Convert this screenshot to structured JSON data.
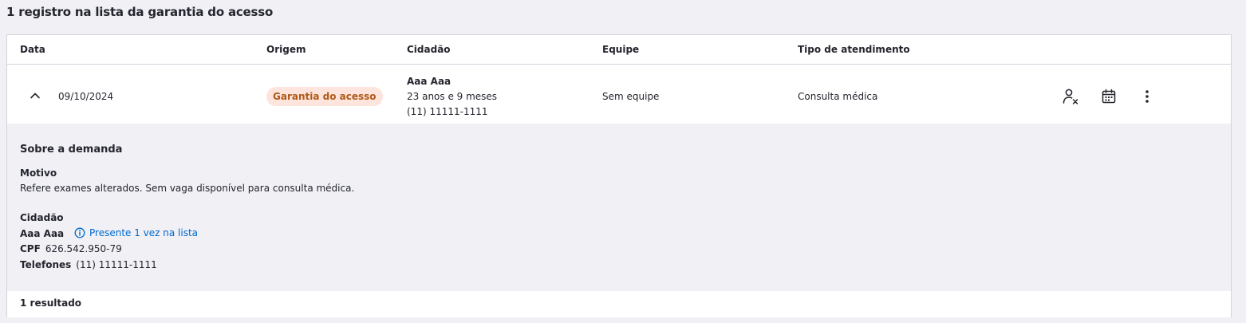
{
  "page": {
    "title": "1 registro na lista da garantia do acesso"
  },
  "table": {
    "headers": {
      "data": "Data",
      "origem": "Origem",
      "cidadao": "Cidadão",
      "equipe": "Equipe",
      "tipo": "Tipo de atendimento"
    },
    "rows": [
      {
        "data": "09/10/2024",
        "origem": "Garantia do acesso",
        "cidadao_nome": "Aaa Aaa",
        "cidadao_idade": "23 anos e 9 meses",
        "cidadao_telefone": "(11) 11111-1111",
        "equipe": "Sem equipe",
        "tipo": "Consulta médica"
      }
    ]
  },
  "details": {
    "title": "Sobre a demanda",
    "motivo_label": "Motivo",
    "motivo_text": "Refere exames alterados. Sem vaga disponível para consulta médica.",
    "cidadao_label": "Cidadão",
    "cidadao_nome": "Aaa Aaa",
    "presente": "Presente 1 vez na lista",
    "cpf_label": "CPF",
    "cpf": "626.542.950-79",
    "telefones_label": "Telefones",
    "telefones": "(11) 11111-1111"
  },
  "footer": {
    "result_count": "1 resultado"
  },
  "icons": {
    "collapse": "chevron-up-icon",
    "remove_citizen": "user-remove-icon",
    "schedule": "calendar-icon",
    "more": "more-vertical-icon",
    "info": "info-icon"
  },
  "colors": {
    "tag_bg": "#fde4dc",
    "tag_text": "#b05a18",
    "link": "#0069d0",
    "expanded_bg": "#f0f0f5"
  }
}
